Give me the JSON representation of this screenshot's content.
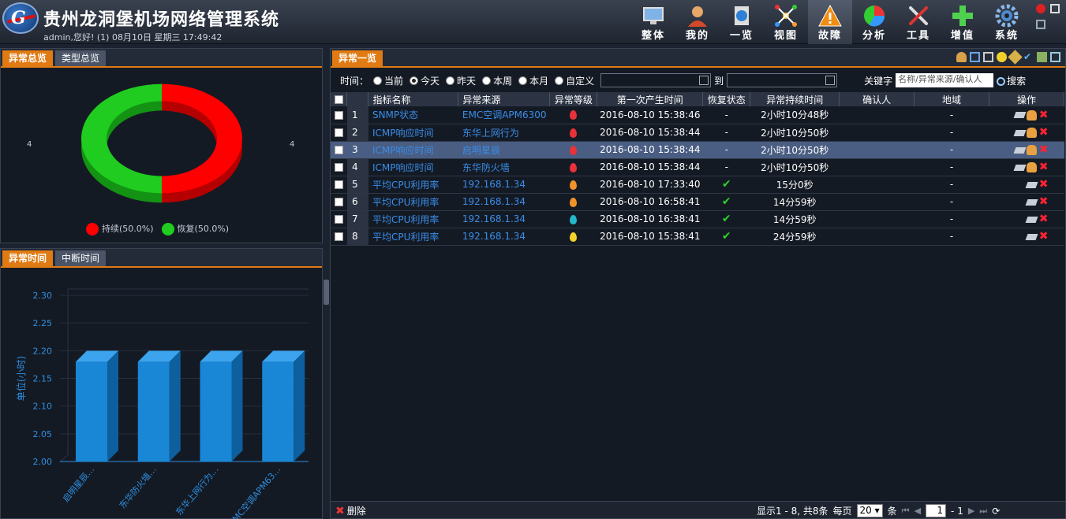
{
  "app": {
    "title": "贵州龙洞堡机场网络管理系统",
    "logo_letter": "G",
    "user_line": "admin,您好! (1) 08月10日 星期三 17:49:42"
  },
  "nav": [
    {
      "label": "整体",
      "icon": "monitor-icon"
    },
    {
      "label": "我的",
      "icon": "user-icon"
    },
    {
      "label": "一览",
      "icon": "globe-icon"
    },
    {
      "label": "视图",
      "icon": "topology-icon"
    },
    {
      "label": "故障",
      "icon": "warning-icon",
      "active": true
    },
    {
      "label": "分析",
      "icon": "pie-chart-icon"
    },
    {
      "label": "工具",
      "icon": "tools-icon"
    },
    {
      "label": "增值",
      "icon": "plus-icon"
    },
    {
      "label": "系统",
      "icon": "gear-icon"
    }
  ],
  "left_top": {
    "tabs": [
      "异常总览",
      "类型总览"
    ],
    "active_tab": 0,
    "side_label_left": "4",
    "side_label_right": "4",
    "pie": [
      {
        "label": "持续(50.0%)",
        "value": 50.0,
        "color": "#ff0000"
      },
      {
        "label": "恢复(50.0%)",
        "value": 50.0,
        "color": "#1fcc1f"
      }
    ]
  },
  "left_bottom": {
    "tabs": [
      "异常时间",
      "中断时间"
    ],
    "active_tab": 0
  },
  "chart_data": {
    "type": "bar",
    "ylabel": "单位(小时)",
    "ylim": [
      2.0,
      2.3
    ],
    "yticks": [
      "2.00",
      "2.05",
      "2.10",
      "2.15",
      "2.20",
      "2.25",
      "2.30"
    ],
    "categories": [
      "启明星辰…",
      "东华防火墙…",
      "东华上网行为…",
      "EMC空调APM63…"
    ],
    "values": [
      2.18,
      2.18,
      2.18,
      2.18
    ],
    "color": "#1a87d6"
  },
  "main": {
    "tab": "异常一览",
    "filter": {
      "time_label": "时间：",
      "options": [
        "当前",
        "今天",
        "昨天",
        "本周",
        "本月",
        "自定义"
      ],
      "selected": 1,
      "to_label": "到",
      "keyword_label": "关键字",
      "keyword_placeholder": "名称/异常来源/确认人",
      "search_label": "搜索"
    },
    "columns": [
      "指标名称",
      "异常来源",
      "异常等级",
      "第一次产生时间",
      "恢复状态",
      "异常持续时间",
      "确认人",
      "地域",
      "操作"
    ],
    "rows": [
      {
        "no": "1",
        "name": "SNMP状态",
        "source": "EMC空调APM6300",
        "level": "#e8323a",
        "time": "2016-08-10 15:38:46",
        "restored": "-",
        "duration": "2小时10分48秒",
        "confirmer": "",
        "region": "-",
        "ops": "full"
      },
      {
        "no": "2",
        "name": "ICMP响应时间",
        "source": "东华上网行为",
        "level": "#e8323a",
        "time": "2016-08-10 15:38:44",
        "restored": "-",
        "duration": "2小时10分50秒",
        "confirmer": "",
        "region": "-",
        "ops": "full"
      },
      {
        "no": "3",
        "name": "ICMP响应时间",
        "source": "启明星辰",
        "level": "#e8323a",
        "time": "2016-08-10 15:38:44",
        "restored": "-",
        "duration": "2小时10分50秒",
        "confirmer": "",
        "region": "-",
        "ops": "full",
        "selected": true
      },
      {
        "no": "4",
        "name": "ICMP响应时间",
        "source": "东华防火墙",
        "level": "#e8323a",
        "time": "2016-08-10 15:38:44",
        "restored": "-",
        "duration": "2小时10分50秒",
        "confirmer": "",
        "region": "-",
        "ops": "full"
      },
      {
        "no": "5",
        "name": "平均CPU利用率",
        "source": "192.168.1.34",
        "level": "#f0922a",
        "time": "2016-08-10 17:33:40",
        "restored": "✔",
        "duration": "15分0秒",
        "confirmer": "",
        "region": "-",
        "ops": "short"
      },
      {
        "no": "6",
        "name": "平均CPU利用率",
        "source": "192.168.1.34",
        "level": "#f0922a",
        "time": "2016-08-10 16:58:41",
        "restored": "✔",
        "duration": "14分59秒",
        "confirmer": "",
        "region": "-",
        "ops": "short"
      },
      {
        "no": "7",
        "name": "平均CPU利用率",
        "source": "192.168.1.34",
        "level": "#25b8c8",
        "time": "2016-08-10 16:38:41",
        "restored": "✔",
        "duration": "14分59秒",
        "confirmer": "",
        "region": "-",
        "ops": "short"
      },
      {
        "no": "8",
        "name": "平均CPU利用率",
        "source": "192.168.1.34",
        "level": "#f2d22a",
        "time": "2016-08-10 15:38:41",
        "restored": "✔",
        "duration": "24分59秒",
        "confirmer": "",
        "region": "-",
        "ops": "short"
      }
    ],
    "footer": {
      "delete_label": "删除",
      "summary": "显示1 - 8, 共8条",
      "per_page_label": "每页",
      "per_page": "20",
      "unit": "条",
      "page_value": "1",
      "page_total": "- 1"
    }
  }
}
